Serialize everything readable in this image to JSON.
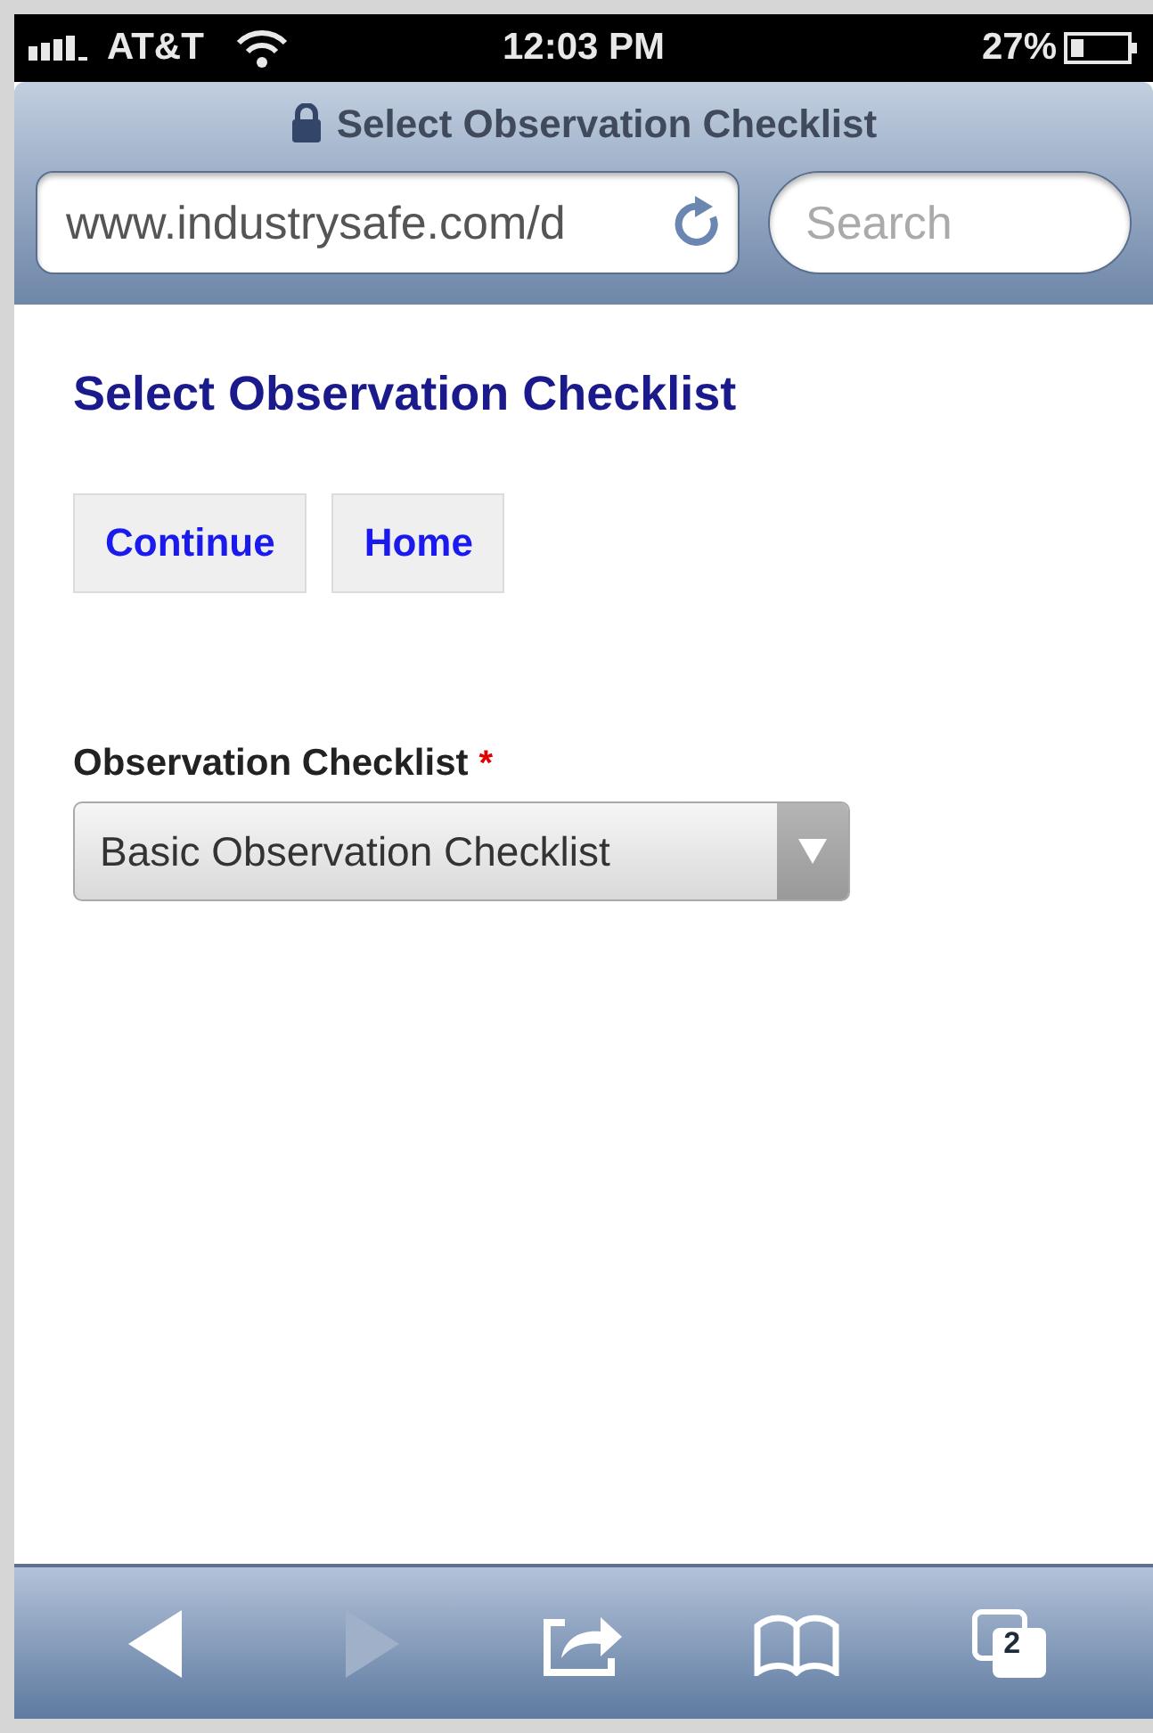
{
  "status_bar": {
    "carrier": "AT&T",
    "time": "12:03 PM",
    "battery": "27%"
  },
  "browser": {
    "title": "Select Observation Checklist",
    "url": "www.industrysafe.com/d",
    "search": {
      "placeholder": "Search"
    }
  },
  "page": {
    "heading": "Select Observation Checklist",
    "buttons": [
      "Continue",
      "Home"
    ],
    "field": {
      "label": "Observation Checklist",
      "required_mark": "*",
      "value": "Basic Observation Checklist"
    }
  },
  "toolbar": {
    "items": [
      {
        "kind": "back",
        "disabled": false
      },
      {
        "kind": "forward",
        "disabled": true
      },
      {
        "kind": "share",
        "disabled": false
      },
      {
        "kind": "bookmarks",
        "disabled": false
      },
      {
        "kind": "tabs",
        "disabled": false,
        "count": "2"
      }
    ]
  }
}
